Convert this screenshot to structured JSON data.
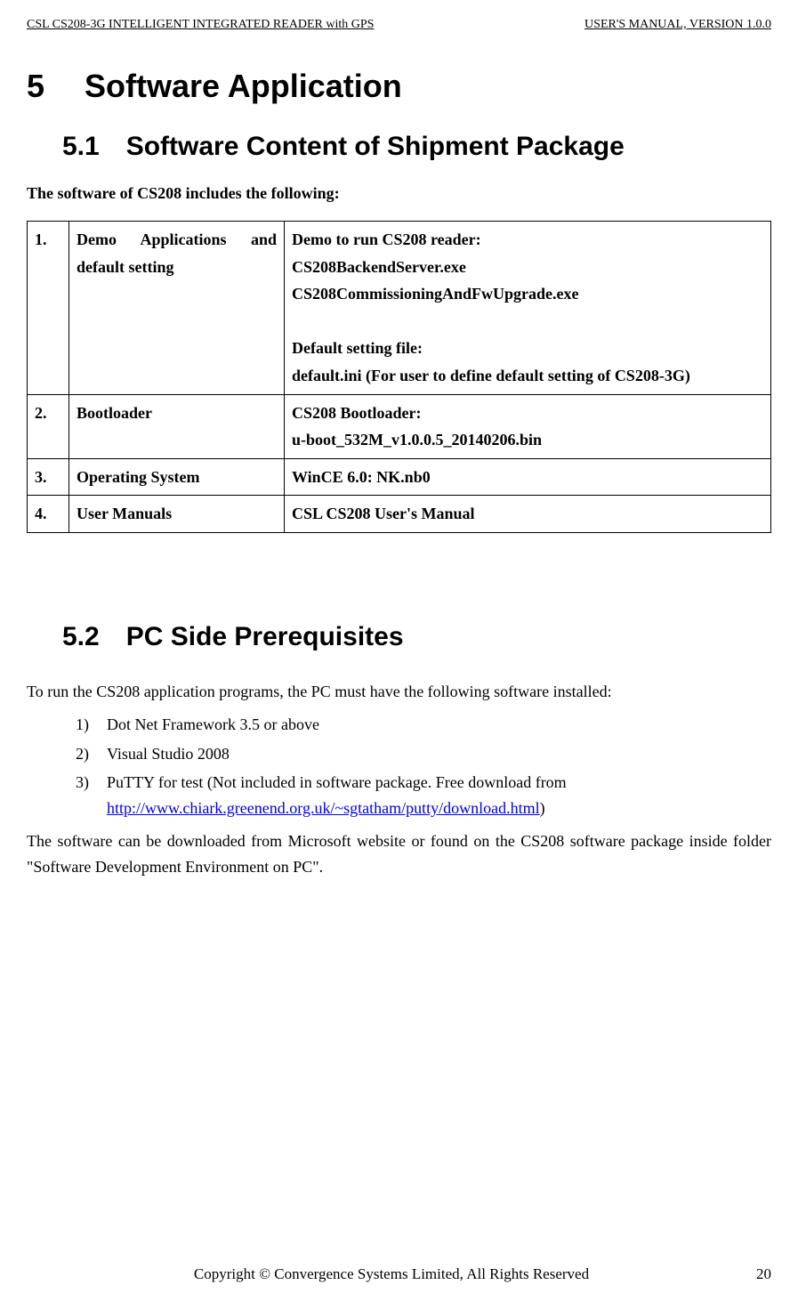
{
  "header": {
    "left": "CSL CS208-3G INTELLIGENT INTEGRATED READER with GPS",
    "right": "USER'S  MANUAL,  VERSION  1.0.0"
  },
  "h1": {
    "num": "5",
    "title": "Software Application"
  },
  "section51": {
    "num": "5.1",
    "title": "Software Content of Shipment Package",
    "intro": "The software of CS208 includes the following:",
    "rows": [
      {
        "n": "1.",
        "label": "Demo Applications and default setting",
        "desc_l1": "Demo to run CS208 reader:",
        "desc_l2": "CS208BackendServer.exe",
        "desc_l3": "CS208CommissioningAndFwUpgrade.exe",
        "desc_l5": "Default setting file:",
        "desc_l6": "default.ini (For user to define default setting of CS208-3G)"
      },
      {
        "n": "2.",
        "label": "Bootloader",
        "desc_l1": "CS208 Bootloader:",
        "desc_l2": "u-boot_532M_v1.0.0.5_20140206.bin"
      },
      {
        "n": "3.",
        "label": "Operating System",
        "desc": "WinCE 6.0:    NK.nb0"
      },
      {
        "n": "4.",
        "label": "User Manuals",
        "desc": "CSL CS208 User's Manual"
      }
    ]
  },
  "section52": {
    "num": "5.2",
    "title": "PC Side Prerequisites",
    "intro": "To run the CS208 application programs, the PC must have the following software installed:",
    "items": [
      {
        "n": "1)",
        "text": "Dot Net Framework 3.5 or above"
      },
      {
        "n": "2)",
        "text": "Visual Studio 2008"
      },
      {
        "n": "3)",
        "text_a": "PuTTY for test (Not included in software package. Free download from ",
        "link": "http://www.chiark.greenend.org.uk/~sgtatham/putty/download.html",
        "text_b": ")"
      }
    ],
    "outro": "The software can be downloaded from Microsoft website or found on the CS208 software package inside folder \"Software Development Environment on PC\"."
  },
  "footer": {
    "center": "Copyright © Convergence Systems Limited, All Rights Reserved",
    "right": "20"
  }
}
